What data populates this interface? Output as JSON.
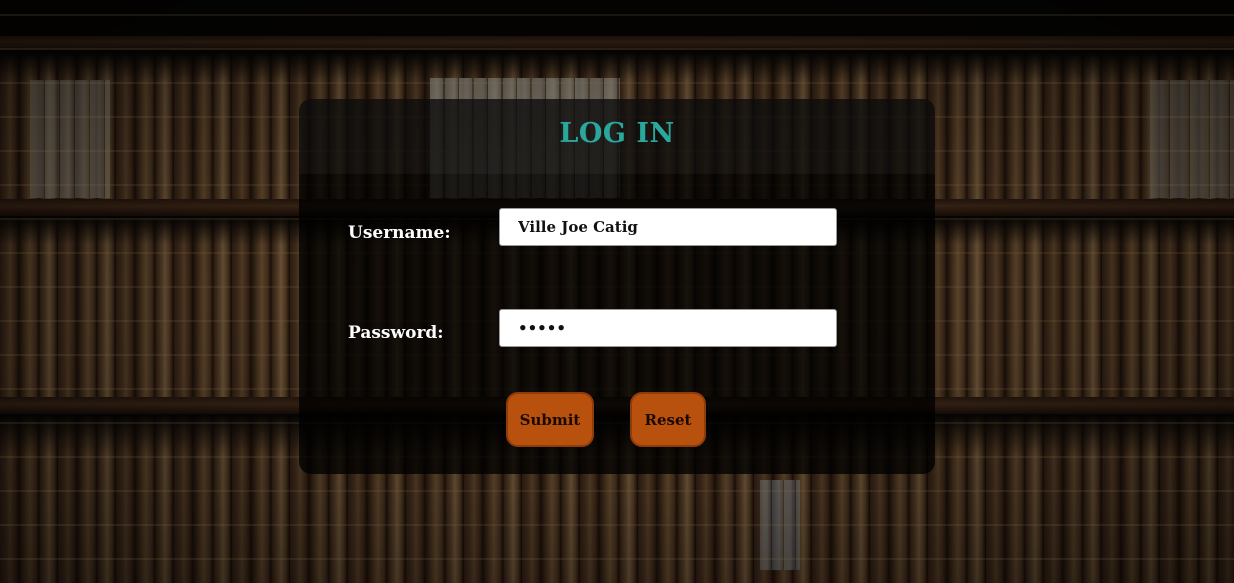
{
  "page": {
    "title": "LOG IN"
  },
  "form": {
    "username": {
      "label": "Username:",
      "value": "Ville Joe Catig"
    },
    "password": {
      "label": "Password:",
      "value": "•••••"
    },
    "submit_label": "Submit",
    "reset_label": "Reset"
  },
  "colors": {
    "title": "#2aa89d",
    "button_fill": "#b8500e",
    "panel_overlay": "rgba(0,0,0,0.78)"
  }
}
